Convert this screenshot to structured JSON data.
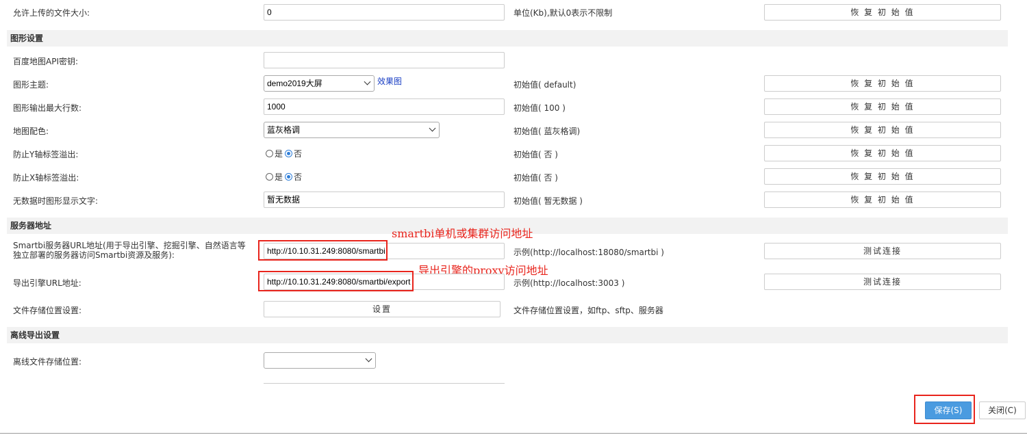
{
  "rows": {
    "upload_size": {
      "label": "允许上传的文件大小:",
      "value": "0",
      "hint": "单位(Kb),默认0表示不限制",
      "button": "恢 复 初 始 值"
    },
    "baidu_key": {
      "label": "百度地图API密钥:",
      "value": ""
    },
    "chart_theme": {
      "label": "图形主题:",
      "value": "demo2019大屏",
      "link": "效果图",
      "hint": "初始值( default)",
      "button": "恢 复 初 始 值"
    },
    "max_rows": {
      "label": "图形输出最大行数:",
      "value": "1000",
      "hint": "初始值( 100 )",
      "button": "恢 复 初 始 值"
    },
    "map_color": {
      "label": "地图配色:",
      "value": "蓝灰格调",
      "hint": "初始值( 蓝灰格调)",
      "button": "恢 复 初 始 值"
    },
    "y_overflow": {
      "label": "防止Y轴标签溢出:",
      "opt_yes": "是",
      "opt_no": "否",
      "hint": "初始值( 否 )",
      "button": "恢 复 初 始 值"
    },
    "x_overflow": {
      "label": "防止X轴标签溢出:",
      "opt_yes": "是",
      "opt_no": "否",
      "hint": "初始值( 否 )",
      "button": "恢 复 初 始 值"
    },
    "no_data_text": {
      "label": "无数据时图形显示文字:",
      "value": "暂无数据",
      "hint": "初始值( 暂无数据 )",
      "button": "恢 复 初 始 值"
    },
    "server_url": {
      "label": "Smartbi服务器URL地址(用于导出引擎、挖掘引擎、自然语言等独立部署的服务器访问Smartbi资源及服务):",
      "value": "http://10.10.31.249:8080/smartbi",
      "hint": "示例(http://localhost:18080/smartbi )",
      "button": "测试连接"
    },
    "export_url": {
      "label": "导出引擎URL地址:",
      "value": "http://10.10.31.249:8080/smartbi/export",
      "hint": "示例(http://localhost:3003 )",
      "button": "测试连接"
    },
    "file_storage": {
      "label": "文件存储位置设置:",
      "button": "设置",
      "hint": "文件存储位置设置，如ftp、sftp、服务器"
    },
    "offline_storage": {
      "label": "离线文件存储位置:",
      "value": ""
    }
  },
  "sections": {
    "chart": "图形设置",
    "server": "服务器地址",
    "offline": "离线导出设置"
  },
  "annotations": {
    "smartbi": "smartbi单机或集群访问地址",
    "export": "导出引擎的proxy访问地址"
  },
  "footer": {
    "save": "保存(S)",
    "close": "关闭(C)"
  },
  "colors": {
    "annotation": "#e8241c",
    "primary_button": "#4a9be0",
    "section_bg": "#f2f2f2"
  }
}
